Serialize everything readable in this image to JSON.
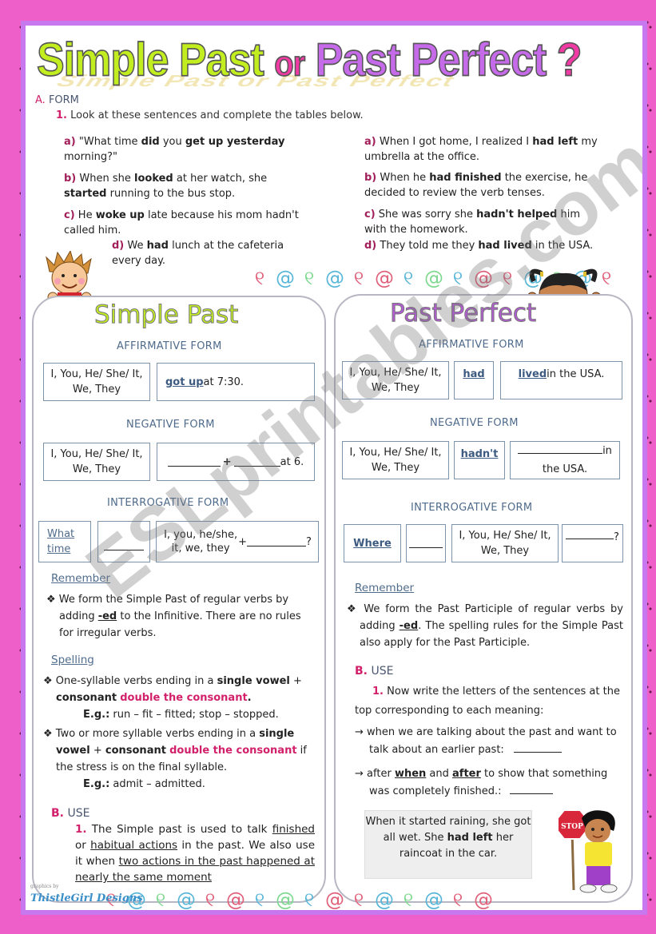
{
  "title": {
    "part1": "Simple Past",
    "connector": "or",
    "part2": "Past Perfect",
    "mark": "?",
    "shadow_text": "Simple Past or Past Perfect"
  },
  "section_a": {
    "letter": "A.",
    "label": "FORM",
    "instruction_num": "1.",
    "instruction": "Look at these sentences and complete the tables below."
  },
  "sentences_left": [
    {
      "label": "a)",
      "pre": "\"What time ",
      "b1": "did",
      "mid": " you ",
      "b2": "get up yesterday",
      "post": " morning?\""
    },
    {
      "label": "b)",
      "pre": "When she ",
      "b1": "looked",
      "mid": " at her watch, she ",
      "b2": "started",
      "post": " running to the bus stop."
    },
    {
      "label": "c)",
      "pre": "He ",
      "b1": "woke up",
      "mid": " late because his mom hadn't called him.",
      "b2": "",
      "post": ""
    },
    {
      "label": "d)",
      "pre": "We ",
      "b1": "had",
      "mid": " lunch at the cafeteria every day.",
      "b2": "",
      "post": ""
    }
  ],
  "sentences_right": [
    {
      "label": "a)",
      "pre": "When I got home, I realized I ",
      "b1": "had left",
      "mid": " my umbrella at the office."
    },
    {
      "label": "b)",
      "pre": "When he ",
      "b1": "had finished",
      "mid": " the exercise, he decided to review the verb tenses."
    },
    {
      "label": "c)",
      "pre": "She was sorry she ",
      "b1": "hadn't helped",
      "mid": " him with the homework."
    },
    {
      "label": "d)",
      "pre": "They told me they ",
      "b1": "had lived",
      "mid": " in the USA."
    }
  ],
  "simple_past": {
    "title": "Simple Past",
    "affirmative": {
      "head": "AFFIRMATIVE FORM",
      "subject": "I, You, He/ She/ It, We, They",
      "verb": "got up",
      "rest": " at 7:30."
    },
    "negative": {
      "head": "NEGATIVE FORM",
      "subject": "I, You, He/ She/ It, We, They",
      "plus": "+",
      "rest": " at 6."
    },
    "interrogative": {
      "head": "INTERROGATIVE FORM",
      "wh": "What time",
      "subject": "I, you, he/she, it, we, they",
      "plus": "+",
      "qmark": "?"
    },
    "remember_label": "Remember",
    "remember": {
      "pre": "We form the Simple Past of regular verbs by adding ",
      "suffix": "-ed",
      "post": " to the Infinitive. There are no rules for irregular verbs."
    },
    "spelling_label": "Spelling",
    "spelling": [
      {
        "pre": "One-syllable verbs ending in a ",
        "b": "single vowel",
        "plus": " + ",
        "b2": "consonant",
        "pink": "double the consonant",
        "post": ".",
        "eg_label": "E.g.:",
        "eg": " run – fit – fitted; stop – stopped."
      },
      {
        "pre": "Two or more syllable verbs ending in a ",
        "b": "single vowel",
        "plus": " + ",
        "b2": "consonant",
        "pink": "double the consonant",
        "post": " if the stress is on the final syllable.",
        "eg_label": "E.g.:",
        "eg": " admit – admitted."
      }
    ],
    "use": {
      "letter": "B.",
      "label": "USE",
      "num": "1.",
      "t1": "The Simple past is used to talk ",
      "u1": "finished",
      "t2": " or ",
      "u2": "habitual actions",
      "t3": " in  the past. We also use it when ",
      "u3": "two actions in the past happened at nearly the same moment"
    }
  },
  "past_perfect": {
    "title": "Past Perfect",
    "affirmative": {
      "head": "AFFIRMATIVE FORM",
      "subject": "I, You, He/ She/ It, We, They",
      "aux": "had",
      "verb": "lived",
      "rest": " in the USA."
    },
    "negative": {
      "head": "NEGATIVE FORM",
      "subject": "I, You, He/ She/ It, We, They",
      "aux": "hadn't",
      "rest": "in the USA."
    },
    "interrogative": {
      "head": "INTERROGATIVE FORM",
      "wh": "Where",
      "subject": "I, You, He/ She/ It, We, They",
      "qmark": "?"
    },
    "remember_label": "Remember",
    "remember": {
      "pre": "We form the Past Participle of regular verbs by adding ",
      "suffix": "-ed",
      "post": ". The spelling rules for the Simple Past also apply for the Past Participle."
    },
    "use": {
      "letter": "B.",
      "label": "USE",
      "num": "1.",
      "instruction": "Now write the letters of the sentences at the top corresponding to each meaning:",
      "items": [
        {
          "arrow": "→",
          "pre": "when we are talking about the past and want to talk about an earlier past:",
          "u1": "",
          "mid": "",
          "u2": "",
          "post": ""
        },
        {
          "arrow": "→",
          "pre": "after ",
          "u1": "when",
          "mid": " and ",
          "u2": "after",
          "post": " to show that something was completely finished.:"
        }
      ]
    },
    "example_box": {
      "pre": "When it started raining, she got all wet. She ",
      "b": "had left",
      "post": " her raincoat in the car."
    }
  },
  "stop_sign": "STOP",
  "brand": {
    "small": "graphics by",
    "name": "ThistleGirl Designs"
  },
  "watermark": "ESLprintables.com",
  "swirl_colors": [
    "#e0607a",
    "#58b6d8",
    "#7fd88f",
    "#58b6d8",
    "#e0607a",
    "#e0607a",
    "#58b6d8",
    "#7fd88f",
    "#58b6d8",
    "#e0607a"
  ],
  "colors": {
    "border_pink": "#ee5fc9",
    "frame_purple": "#c778ee",
    "title_green": "#c2ee1f",
    "title_purple": "#c56ae8",
    "accent_pink": "#d2206a",
    "heading_blue": "#4f6b8c"
  }
}
